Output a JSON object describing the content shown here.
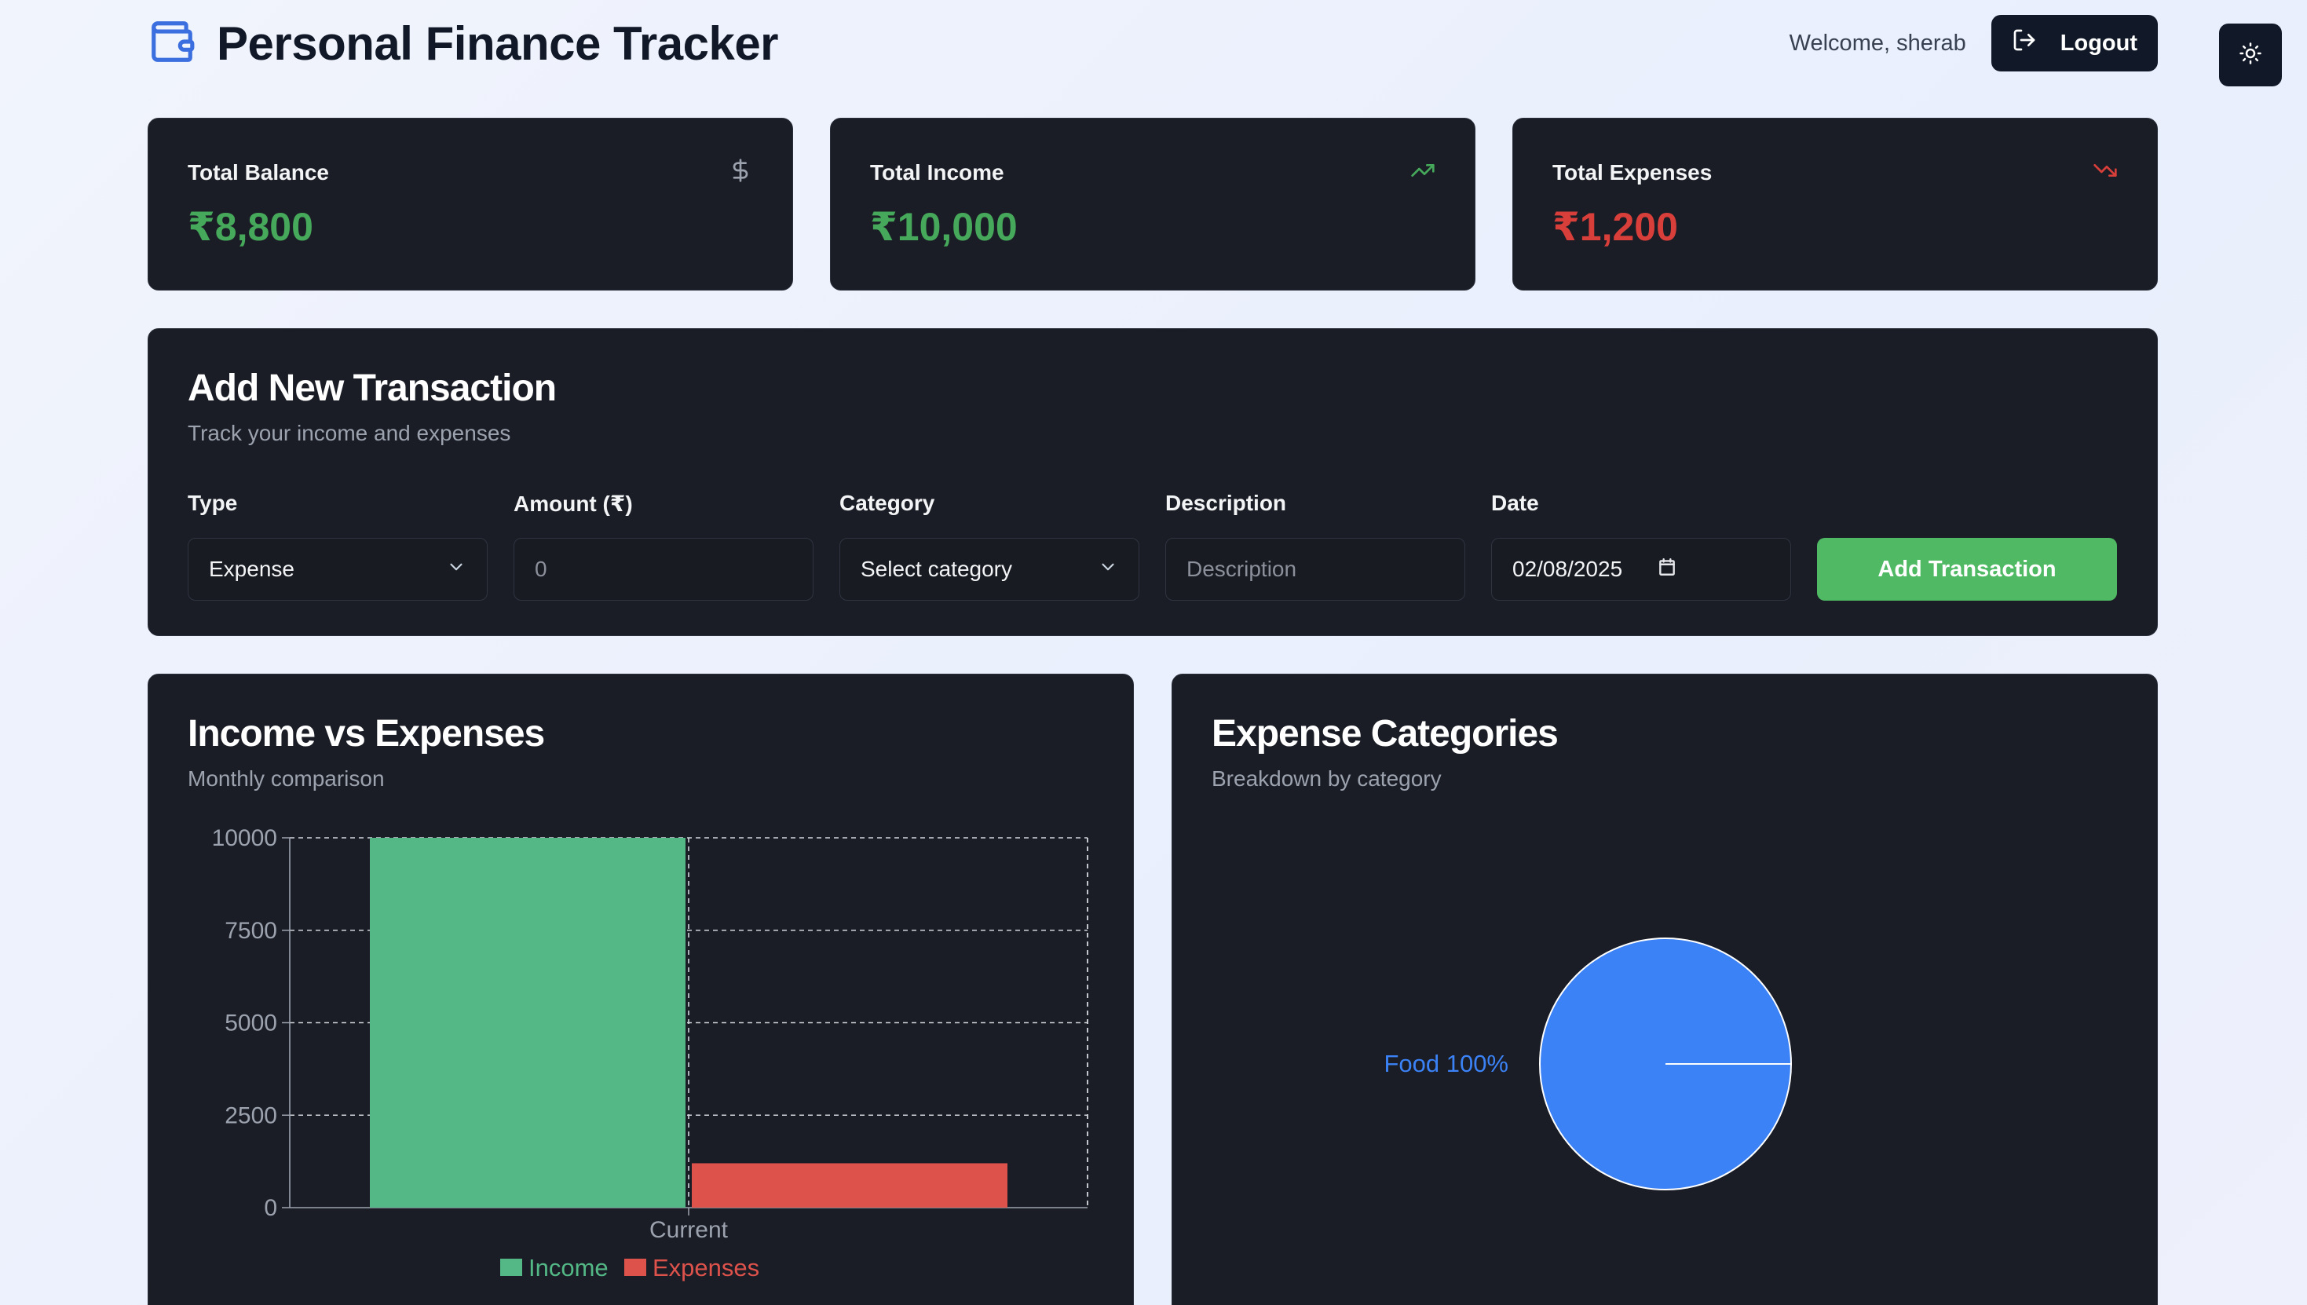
{
  "header": {
    "title": "Personal Finance Tracker",
    "welcome": "Welcome, sherab",
    "logout_label": "Logout"
  },
  "stats": [
    {
      "title": "Total Balance",
      "value": "₹8,800",
      "color": "#46a85a",
      "icon": "dollar-icon"
    },
    {
      "title": "Total Income",
      "value": "₹10,000",
      "color": "#46a85a",
      "icon": "trending-up-icon"
    },
    {
      "title": "Total Expenses",
      "value": "₹1,200",
      "color": "#d93f3a",
      "icon": "trending-down-icon"
    }
  ],
  "form": {
    "title": "Add New Transaction",
    "subtitle": "Track your income and expenses",
    "type_label": "Type",
    "type_value": "Expense",
    "amount_label": "Amount (₹)",
    "amount_placeholder": "0",
    "category_label": "Category",
    "category_value": "Select category",
    "description_label": "Description",
    "description_placeholder": "Description",
    "date_label": "Date",
    "date_value": "02/08/2025",
    "submit_label": "Add Transaction"
  },
  "income_chart": {
    "title": "Income vs Expenses",
    "subtitle": "Monthly comparison"
  },
  "category_chart": {
    "title": "Expense Categories",
    "subtitle": "Breakdown by category"
  },
  "colors": {
    "income": "#53b886",
    "expenses": "#de524c",
    "pie": "#3b82f6",
    "green_text": "#46a85a",
    "red_text": "#d93f3a"
  },
  "chart_data": [
    {
      "type": "bar",
      "categories": [
        "Current"
      ],
      "series": [
        {
          "name": "Income",
          "values": [
            10000
          ]
        },
        {
          "name": "Expenses",
          "values": [
            1200
          ]
        }
      ],
      "yticks": [
        "0",
        "2500",
        "5000",
        "7500",
        "10000"
      ],
      "ylim": [
        0,
        10000
      ],
      "grid": true,
      "legend": "bottom"
    },
    {
      "type": "pie",
      "labels": [
        "Food"
      ],
      "values": [
        100
      ],
      "data_labels": [
        "Food 100%"
      ]
    }
  ]
}
